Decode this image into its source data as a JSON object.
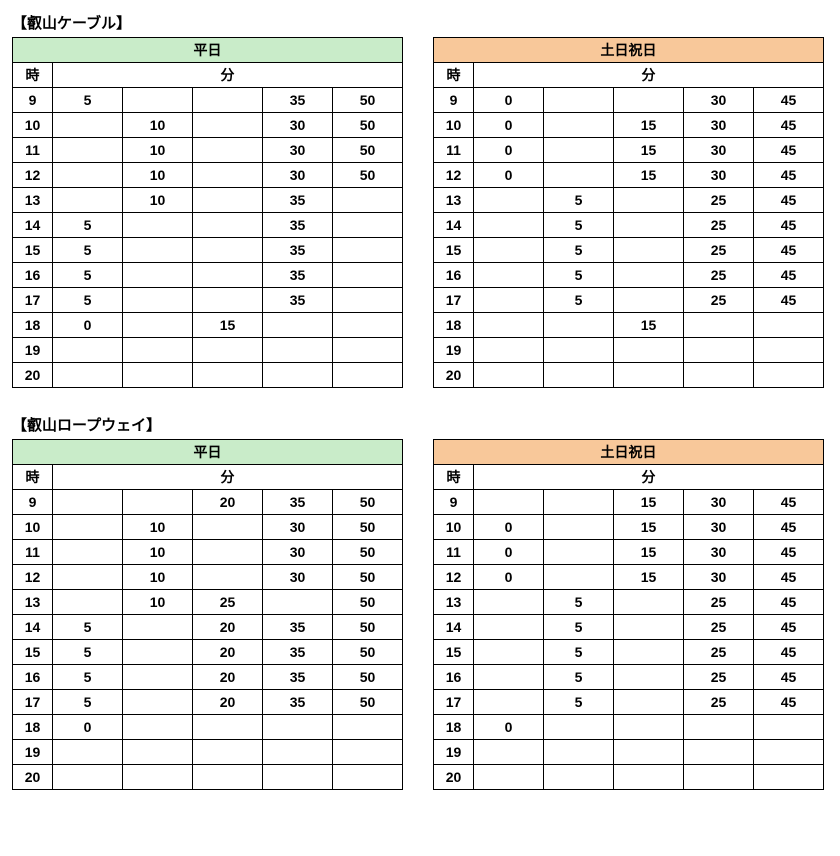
{
  "labels": {
    "hour": "時",
    "minute": "分",
    "weekday": "平日",
    "holiday": "土日祝日"
  },
  "sections": [
    {
      "title": "【叡山ケーブル】",
      "hours": [
        9,
        10,
        11,
        12,
        13,
        14,
        15,
        16,
        17,
        18,
        19,
        20
      ],
      "weekday": {
        "9": [
          "5",
          "",
          "",
          "35",
          "50"
        ],
        "10": [
          "",
          "10",
          "",
          "30",
          "50"
        ],
        "11": [
          "",
          "10",
          "",
          "30",
          "50"
        ],
        "12": [
          "",
          "10",
          "",
          "30",
          "50"
        ],
        "13": [
          "",
          "10",
          "",
          "35",
          ""
        ],
        "14": [
          "5",
          "",
          "",
          "35",
          ""
        ],
        "15": [
          "5",
          "",
          "",
          "35",
          ""
        ],
        "16": [
          "5",
          "",
          "",
          "35",
          ""
        ],
        "17": [
          "5",
          "",
          "",
          "35",
          ""
        ],
        "18": [
          "0",
          "",
          "15",
          "",
          ""
        ],
        "19": [
          "",
          "",
          "",
          "",
          ""
        ],
        "20": [
          "",
          "",
          "",
          "",
          ""
        ]
      },
      "holiday": {
        "9": [
          "0",
          "",
          "",
          "30",
          "45"
        ],
        "10": [
          "0",
          "",
          "15",
          "30",
          "45"
        ],
        "11": [
          "0",
          "",
          "15",
          "30",
          "45"
        ],
        "12": [
          "0",
          "",
          "15",
          "30",
          "45"
        ],
        "13": [
          "",
          "5",
          "",
          "25",
          "45"
        ],
        "14": [
          "",
          "5",
          "",
          "25",
          "45"
        ],
        "15": [
          "",
          "5",
          "",
          "25",
          "45"
        ],
        "16": [
          "",
          "5",
          "",
          "25",
          "45"
        ],
        "17": [
          "",
          "5",
          "",
          "25",
          "45"
        ],
        "18": [
          "",
          "",
          "15",
          "",
          ""
        ],
        "19": [
          "",
          "",
          "",
          "",
          ""
        ],
        "20": [
          "",
          "",
          "",
          "",
          ""
        ]
      }
    },
    {
      "title": "【叡山ロープウェイ】",
      "hours": [
        9,
        10,
        11,
        12,
        13,
        14,
        15,
        16,
        17,
        18,
        19,
        20
      ],
      "weekday": {
        "9": [
          "",
          "",
          "20",
          "35",
          "50"
        ],
        "10": [
          "",
          "10",
          "",
          "30",
          "50"
        ],
        "11": [
          "",
          "10",
          "",
          "30",
          "50"
        ],
        "12": [
          "",
          "10",
          "",
          "30",
          "50"
        ],
        "13": [
          "",
          "10",
          "25",
          "",
          "50"
        ],
        "14": [
          "5",
          "",
          "20",
          "35",
          "50"
        ],
        "15": [
          "5",
          "",
          "20",
          "35",
          "50"
        ],
        "16": [
          "5",
          "",
          "20",
          "35",
          "50"
        ],
        "17": [
          "5",
          "",
          "20",
          "35",
          "50"
        ],
        "18": [
          "0",
          "",
          "",
          "",
          ""
        ],
        "19": [
          "",
          "",
          "",
          "",
          ""
        ],
        "20": [
          "",
          "",
          "",
          "",
          ""
        ]
      },
      "holiday": {
        "9": [
          "",
          "",
          "15",
          "30",
          "45"
        ],
        "10": [
          "0",
          "",
          "15",
          "30",
          "45"
        ],
        "11": [
          "0",
          "",
          "15",
          "30",
          "45"
        ],
        "12": [
          "0",
          "",
          "15",
          "30",
          "45"
        ],
        "13": [
          "",
          "5",
          "",
          "25",
          "45"
        ],
        "14": [
          "",
          "5",
          "",
          "25",
          "45"
        ],
        "15": [
          "",
          "5",
          "",
          "25",
          "45"
        ],
        "16": [
          "",
          "5",
          "",
          "25",
          "45"
        ],
        "17": [
          "",
          "5",
          "",
          "25",
          "45"
        ],
        "18": [
          "0",
          "",
          "",
          "",
          ""
        ],
        "19": [
          "",
          "",
          "",
          "",
          ""
        ],
        "20": [
          "",
          "",
          "",
          "",
          ""
        ]
      }
    }
  ]
}
